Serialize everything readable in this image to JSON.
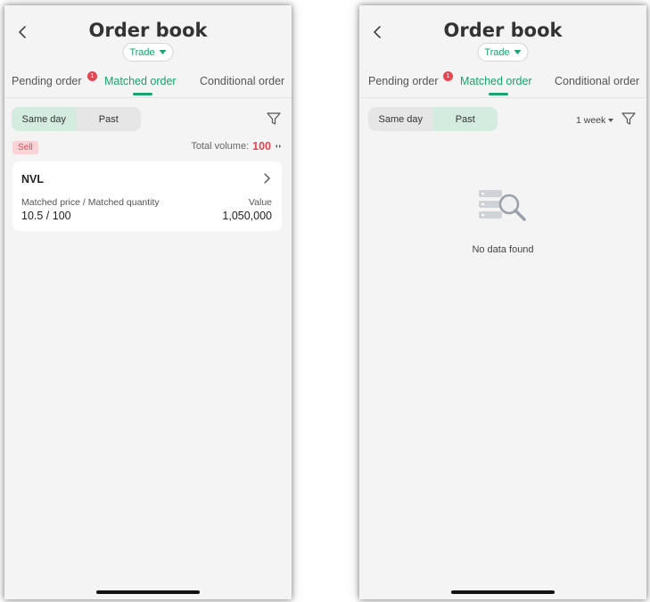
{
  "screens": [
    {
      "title": "Order book",
      "trade_label": "Trade",
      "tabs": {
        "pending": "Pending order",
        "matched": "Matched order",
        "conditional": "Conditional order"
      },
      "pending_badge": "1",
      "segment": {
        "same_day": "Same day",
        "past": "Past",
        "active": "same_day"
      },
      "side_label": "Sell",
      "total_label": "Total volume:",
      "total_value": "100",
      "order": {
        "symbol": "NVL",
        "left_label": "Matched price / Matched quantity",
        "left_value": "10.5 / 100",
        "right_label": "Value",
        "right_value": "1,050,000"
      }
    },
    {
      "title": "Order book",
      "trade_label": "Trade",
      "tabs": {
        "pending": "Pending order",
        "matched": "Matched order",
        "conditional": "Conditional order"
      },
      "pending_badge": "1",
      "segment": {
        "same_day": "Same day",
        "past": "Past",
        "active": "past"
      },
      "period": "1 week",
      "empty_text": "No data found"
    }
  ],
  "colors": {
    "accent": "#1aa36a",
    "sell": "#e64553",
    "badge": "#e64553",
    "active_segment": "#d4ece0"
  },
  "icons": [
    "chevron-left-icon",
    "caret-down-icon",
    "filter-icon",
    "sort-arrows-icon",
    "chevron-right-icon",
    "no-data-search-icon"
  ]
}
